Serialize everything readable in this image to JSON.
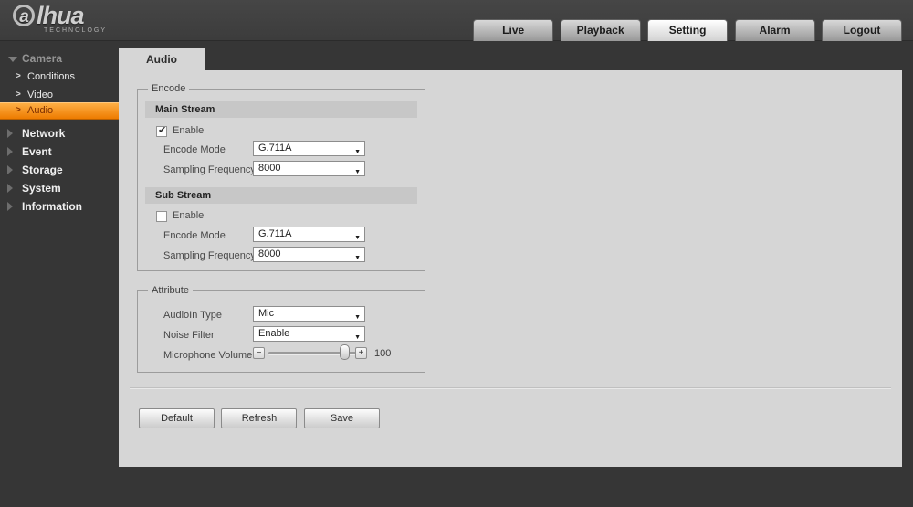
{
  "brand": {
    "name_first": "a",
    "name_rest": "lhua",
    "tagline": "TECHNOLOGY"
  },
  "icons": {
    "checkmark": "✔",
    "dropdown_arrow": "▼",
    "minus": "−",
    "plus": "+"
  },
  "nav": {
    "items": [
      {
        "label": "Live",
        "active": false
      },
      {
        "label": "Playback",
        "active": false
      },
      {
        "label": "Setting",
        "active": true
      },
      {
        "label": "Alarm",
        "active": false
      },
      {
        "label": "Logout",
        "active": false
      }
    ]
  },
  "sidebar": {
    "camera": {
      "label": "Camera",
      "expanded": true
    },
    "camera_children": [
      {
        "label": "Conditions",
        "active": false
      },
      {
        "label": "Video",
        "active": false
      },
      {
        "label": "Audio",
        "active": true
      }
    ],
    "items": [
      {
        "label": "Network"
      },
      {
        "label": "Event"
      },
      {
        "label": "Storage"
      },
      {
        "label": "System"
      },
      {
        "label": "Information"
      }
    ],
    "active_color": "#ee7b00"
  },
  "tabs": {
    "active": "Audio"
  },
  "encode": {
    "legend": "Encode",
    "main_stream": {
      "title": "Main Stream",
      "enable_label": "Enable",
      "enabled": true,
      "encode_mode": {
        "label": "Encode Mode",
        "value": "G.711A"
      },
      "sampling_frequency": {
        "label": "Sampling Frequency",
        "value": "8000"
      }
    },
    "sub_stream": {
      "title": "Sub Stream",
      "enable_label": "Enable",
      "enabled": false,
      "encode_mode": {
        "label": "Encode Mode",
        "value": "G.711A"
      },
      "sampling_frequency": {
        "label": "Sampling Frequency",
        "value": "8000"
      }
    }
  },
  "attribute": {
    "legend": "Attribute",
    "audioin_type": {
      "label": "AudioIn Type",
      "value": "Mic"
    },
    "noise_filter": {
      "label": "Noise Filter",
      "value": "Enable"
    },
    "microphone_volume": {
      "label": "Microphone Volume",
      "value": "100",
      "max": 100
    }
  },
  "footer": {
    "buttons": [
      {
        "label": "Default"
      },
      {
        "label": "Refresh"
      },
      {
        "label": "Save"
      }
    ]
  }
}
